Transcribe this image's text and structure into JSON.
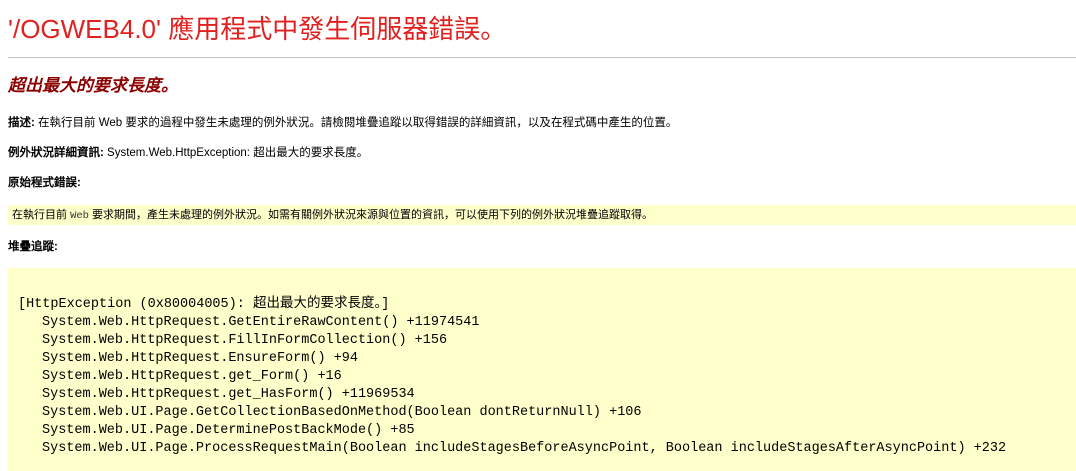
{
  "error_page": {
    "title": "'/OGWEB4.0' 應用程式中發生伺服器錯誤。",
    "message": "超出最大的要求長度。",
    "description": {
      "label": "描述:",
      "text": " 在執行目前 Web 要求的過程中發生未處理的例外狀況。請檢閱堆疊追蹤以取得錯誤的詳細資訊，以及在程式碼中產生的位置。"
    },
    "exception_details": {
      "label": "例外狀況詳細資訊:",
      "text": " System.Web.HttpException: 超出最大的要求長度。"
    },
    "source_error": {
      "label": "原始程式錯誤:",
      "text_before": "在執行目前 ",
      "text_code": "Web",
      "text_after": " 要求期間，產生未處理的例外狀況。如需有關例外狀況來源與位置的資訊，可以使用下列的例外狀況堆疊追蹤取得。"
    },
    "stack_trace": {
      "label": "堆疊追蹤:",
      "header": "[HttpException (0x80004005): 超出最大的要求長度。]",
      "lines": [
        "System.Web.HttpRequest.GetEntireRawContent() +11974541",
        "System.Web.HttpRequest.FillInFormCollection() +156",
        "System.Web.HttpRequest.EnsureForm() +94",
        "System.Web.HttpRequest.get_Form() +16",
        "System.Web.HttpRequest.get_HasForm() +11969534",
        "System.Web.UI.Page.GetCollectionBasedOnMethod(Boolean dontReturnNull) +106",
        "System.Web.UI.Page.DeterminePostBackMode() +85",
        "System.Web.UI.Page.ProcessRequestMain(Boolean includeStagesBeforeAsyncPoint, Boolean includeStagesAfterAsyncPoint) +232"
      ]
    },
    "colors": {
      "title": "#e0211f",
      "subtitle": "#8b0000",
      "code_background": "#ffffcc"
    }
  }
}
